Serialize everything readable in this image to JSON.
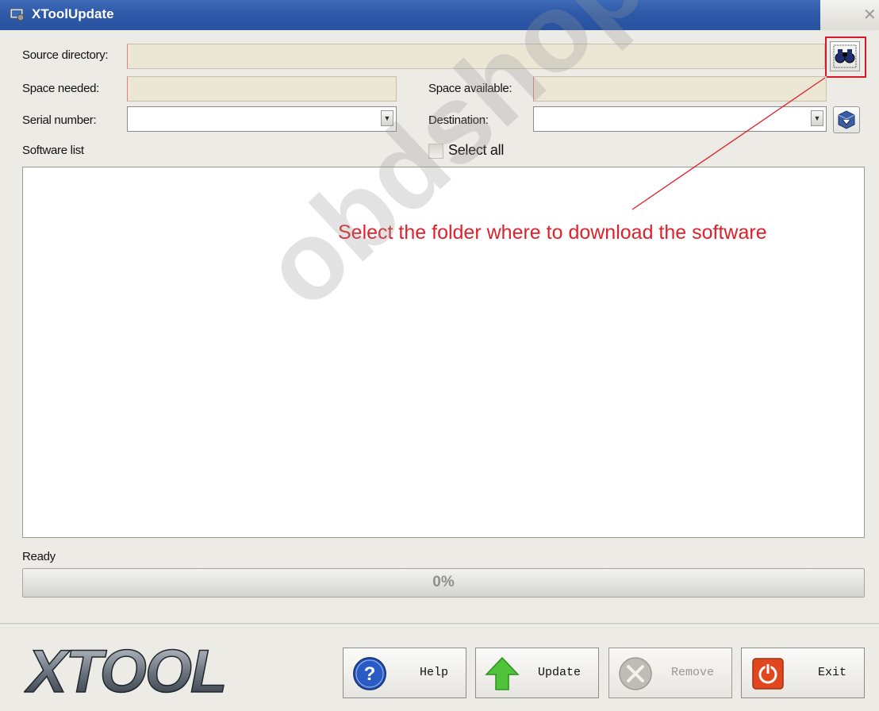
{
  "window": {
    "title": "XToolUpdate",
    "icon": "app-icon",
    "close_icon": "close-icon"
  },
  "form": {
    "source_directory_label": "Source directory:",
    "source_directory_value": "",
    "space_needed_label": "Space needed:",
    "space_needed_value": "",
    "space_available_label": "Space available:",
    "space_available_value": "",
    "serial_number_label": "Serial number:",
    "serial_number_value": "",
    "destination_label": "Destination:",
    "destination_value": "",
    "software_list_label": "Software list",
    "select_all_label": "Select all"
  },
  "annotation": {
    "text": "Select the folder where to download the software",
    "color": "#e0202a"
  },
  "status": {
    "text": "Ready",
    "progress_text": "0%",
    "progress_fraction": 0
  },
  "logo": {
    "text": "XTOOL"
  },
  "buttons": {
    "help": "Help",
    "update": "Update",
    "remove": "Remove",
    "exit": "Exit"
  },
  "watermark": {
    "text": "obdshop.co.uk"
  },
  "colors": {
    "titlebar": "#2e59a8",
    "annotation": "#e0202a",
    "field_bg": "#ece6d5"
  }
}
